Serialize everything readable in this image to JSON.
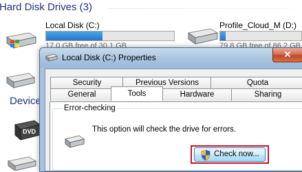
{
  "explorer": {
    "section_hdd": "Hard Disk Drives (3)",
    "section_devices": "Device",
    "drives": [
      {
        "name": "Local Disk (C:)",
        "free_text": "17.0 GB free of 30.1 GB",
        "used_fraction": 0.44
      },
      {
        "name": "Profile_Cloud_M (D:)",
        "free_text": "79.8 GB free of 86.2 GB",
        "used_fraction": 0.07
      }
    ],
    "dvd_label": "DVD"
  },
  "dialog": {
    "title": "Local Disk (C:) Properties",
    "close_glyph": "✕",
    "tabs_back": [
      "Security",
      "Previous Versions",
      "Quota"
    ],
    "tabs_front": [
      "General",
      "Tools",
      "Hardware",
      "Sharing"
    ],
    "active_tab": "Tools",
    "group_label": "Error-checking",
    "message": "This option will check the drive for errors.",
    "check_button": "Check now..."
  },
  "colors": {
    "section_title": "#1e3287",
    "highlight": "#c8102e",
    "progress": "#2676c9"
  },
  "icons": [
    "hard-drive-icon",
    "dvd-drive-icon",
    "shield-icon",
    "properties-icon"
  ]
}
